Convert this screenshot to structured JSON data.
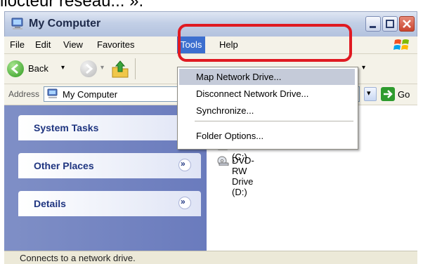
{
  "caption_fragment": "llocteur réseau... ».",
  "window": {
    "title": "My Computer",
    "icon": "my-computer-icon"
  },
  "menubar": {
    "items": [
      "File",
      "Edit",
      "View",
      "Favorites",
      "Tools",
      "Help"
    ],
    "active": "Tools"
  },
  "toolbar": {
    "back_label": "Back",
    "back_dropdown": "▾",
    "forward_dropdown": "▾",
    "extra_dropdown": "▾"
  },
  "address": {
    "label": "Address",
    "value": "My Computer",
    "go_label": "Go",
    "dropdown": "▾"
  },
  "tools_menu": {
    "items": [
      "Map Network Drive...",
      "Disconnect Network Drive...",
      "Synchronize...",
      "Folder Options..."
    ],
    "highlighted": "Map Network Drive..."
  },
  "tasks": {
    "chevron": "»",
    "sections": [
      "System Tasks",
      "Other Places",
      "Details"
    ]
  },
  "drives": [
    {
      "label": "OS (C:)",
      "icon": "hard-drive-icon"
    },
    {
      "label": "DVD-RW Drive (D:)",
      "icon": "dvd-drive-icon"
    }
  ],
  "status": {
    "text": "Connects to a network drive."
  },
  "colors": {
    "highlight_border": "#e01a22",
    "active_menu": "#3c6fcf",
    "task_pane": "#7f8fc6"
  }
}
